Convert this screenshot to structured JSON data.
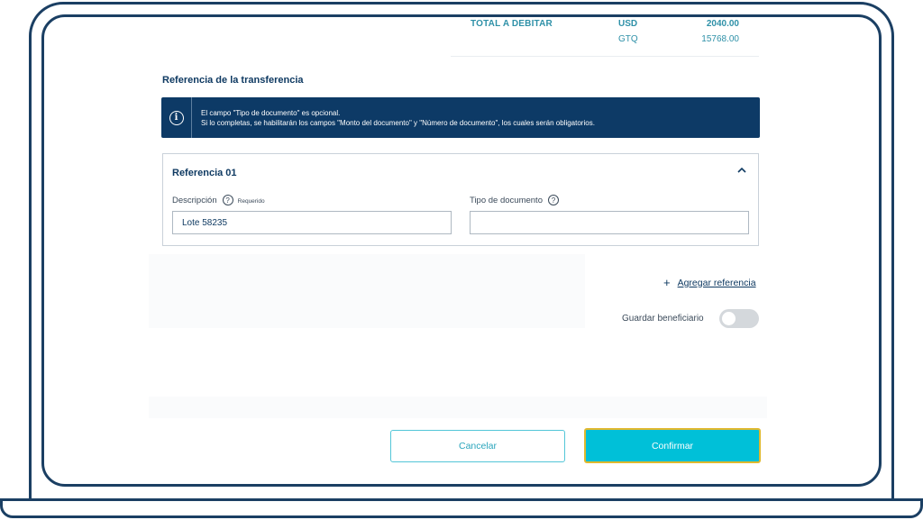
{
  "summary": {
    "total_label": "TOTAL A DEBITAR",
    "rows": [
      {
        "currency": "USD",
        "amount": "2040.00"
      },
      {
        "currency": "GTQ",
        "amount": "15768.00"
      }
    ]
  },
  "section": {
    "title": "Referencia de la transferencia"
  },
  "info_banner": {
    "line1": "El campo \"Tipo de documento\" es opcional.",
    "line2": "Si lo completas, se habilitarán los campos \"Monto del documento\" y \"Número de documento\", los cuales serán obligatorios."
  },
  "reference_card": {
    "title": "Referencia 01",
    "description_label": "Descripción",
    "required_tag": "Requerido",
    "description_value": "Lote 58235",
    "doc_type_label": "Tipo de documento",
    "doc_type_value": ""
  },
  "actions": {
    "add_reference": "Agregar referencia",
    "save_beneficiary": "Guardar beneficiario",
    "save_beneficiary_on": false,
    "cancel": "Cancelar",
    "confirm": "Confirmar"
  },
  "colors": {
    "primary_dark": "#0d3a66",
    "accent": "#00c0d8",
    "frame": "#1b3f63"
  }
}
